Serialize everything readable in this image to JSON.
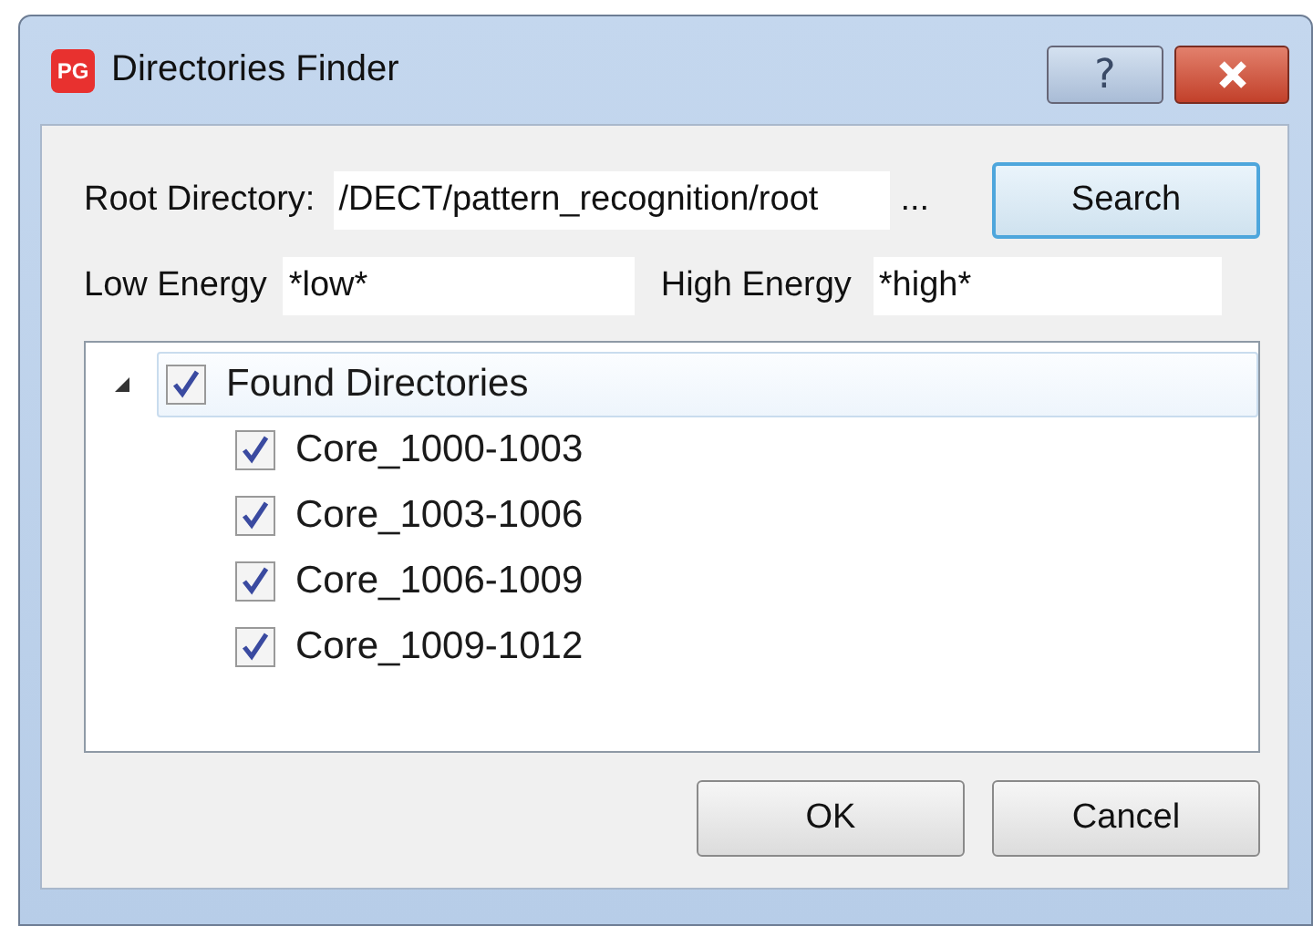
{
  "window": {
    "title": "Directories Finder",
    "app_badge": "PG"
  },
  "title_buttons": [
    {
      "kind": "help",
      "label": "?"
    },
    {
      "kind": "close"
    }
  ],
  "root_directory": {
    "label": "Root Directory:",
    "value": "/DECT/pattern_recognition/root",
    "browse": "..."
  },
  "search_button": "Search",
  "low_energy": {
    "label": "Low Energy",
    "value": "*low*"
  },
  "high_energy": {
    "label": "High Energy",
    "value": "*high*"
  },
  "tree": [
    {
      "label": "Found Directories",
      "checked": true,
      "expanded": true,
      "selected": true,
      "children": [
        {
          "label": "Core_1000-1003",
          "checked": true,
          "selected": false
        },
        {
          "label": "Core_1003-1006",
          "checked": true,
          "selected": false
        },
        {
          "label": "Core_1006-1009",
          "checked": true,
          "selected": false
        },
        {
          "label": "Core_1009-1012",
          "checked": true,
          "selected": false
        }
      ]
    }
  ],
  "buttons": [
    "OK",
    "Cancel"
  ]
}
